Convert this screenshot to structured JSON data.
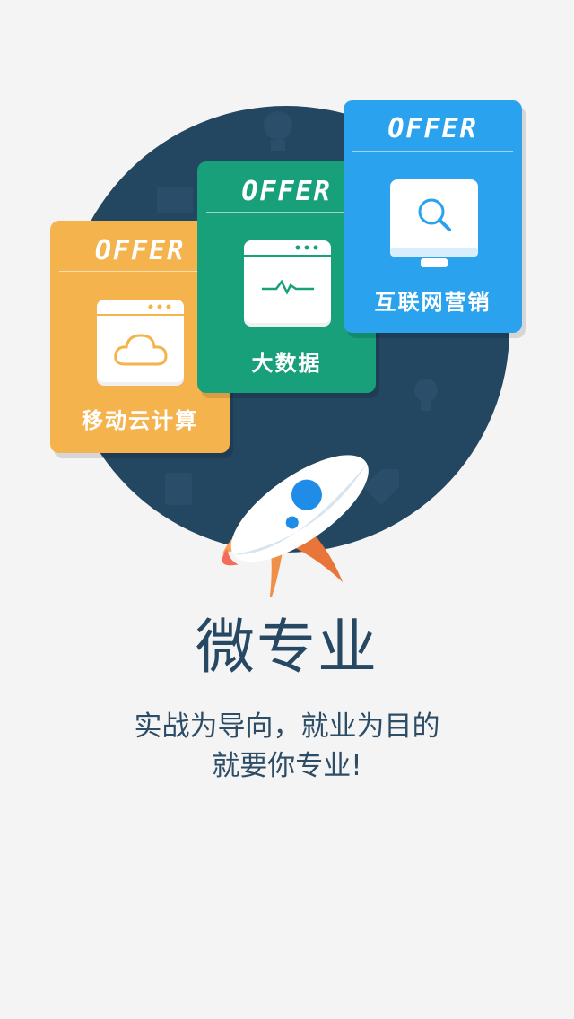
{
  "title": "微专业",
  "subtitle_line1": "实战为导向，就业为目的",
  "subtitle_line2": "就要你专业!",
  "cards": [
    {
      "offer": "OFFER",
      "label": "移动云计算",
      "icon": "cloud-icon",
      "color": "#f5b34d"
    },
    {
      "offer": "OFFER",
      "label": "大数据",
      "icon": "pulse-chart-icon",
      "color": "#17a07a"
    },
    {
      "offer": "OFFER",
      "label": "互联网营销",
      "icon": "search-monitor-icon",
      "color": "#2aa2ee"
    }
  ],
  "colors": {
    "background": "#f4f4f4",
    "circle": "#234661",
    "title_text": "#274863",
    "rocket_body": "#ffffff",
    "rocket_window": "#1f8de8",
    "rocket_fin": "#f08a3c"
  },
  "icons": [
    "rocket-icon",
    "cloud-icon",
    "pulse-chart-icon",
    "search-monitor-icon"
  ]
}
